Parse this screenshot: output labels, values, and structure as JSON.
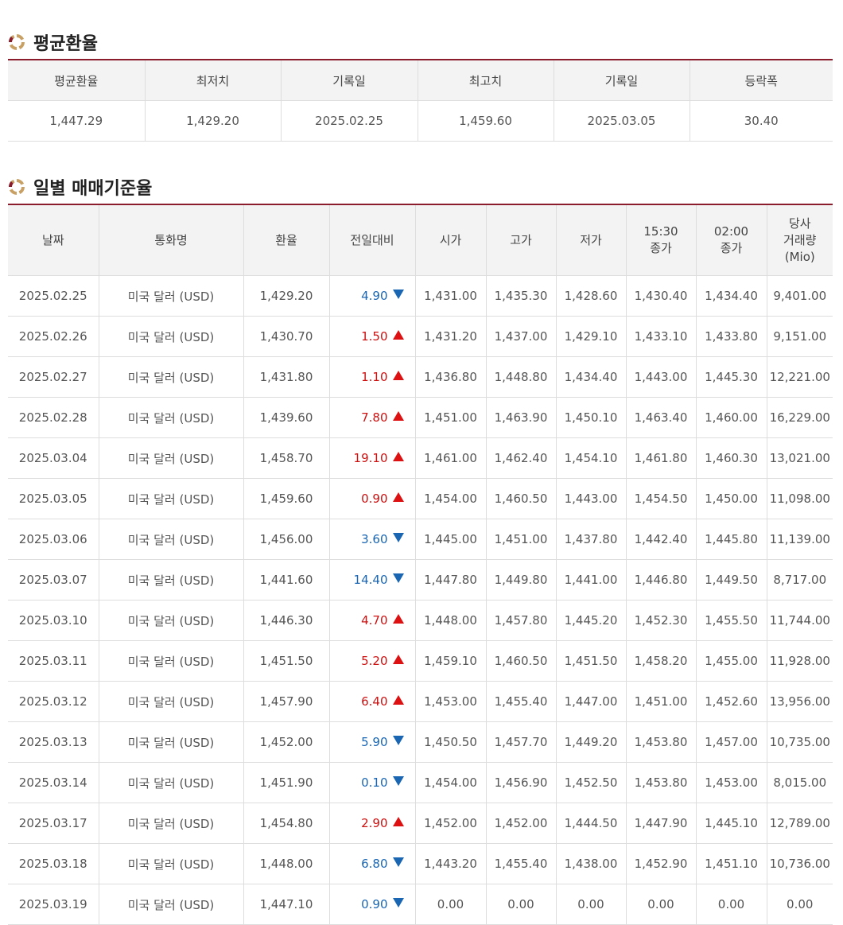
{
  "colors": {
    "accent": "#8a1c2b",
    "up": "#cc1111",
    "down": "#1a66b3"
  },
  "average_section": {
    "title": "평균환율",
    "headers": [
      "평균환율",
      "최저치",
      "기록일",
      "최고치",
      "기록일",
      "등락폭"
    ],
    "values": [
      "1,447.29",
      "1,429.20",
      "2025.02.25",
      "1,459.60",
      "2025.03.05",
      "30.40"
    ]
  },
  "daily_section": {
    "title": "일별 매매기준율",
    "headers": [
      {
        "lines": [
          "날짜"
        ]
      },
      {
        "lines": [
          "통화명"
        ]
      },
      {
        "lines": [
          "환율"
        ]
      },
      {
        "lines": [
          "전일대비"
        ]
      },
      {
        "lines": [
          "시가"
        ]
      },
      {
        "lines": [
          "고가"
        ]
      },
      {
        "lines": [
          "저가"
        ]
      },
      {
        "lines": [
          "15:30",
          "종가"
        ]
      },
      {
        "lines": [
          "02:00",
          "종가"
        ]
      },
      {
        "lines": [
          "당사",
          "거래량",
          "(Mio)"
        ]
      }
    ],
    "rows": [
      {
        "date": "2025.02.25",
        "currency": "미국 달러 (USD)",
        "rate": "1,429.20",
        "change": "4.90",
        "direction": "down",
        "open": "1,431.00",
        "high": "1,435.30",
        "low": "1,428.60",
        "close1530": "1,430.40",
        "close0200": "1,434.40",
        "volume": "9,401.00"
      },
      {
        "date": "2025.02.26",
        "currency": "미국 달러 (USD)",
        "rate": "1,430.70",
        "change": "1.50",
        "direction": "up",
        "open": "1,431.20",
        "high": "1,437.00",
        "low": "1,429.10",
        "close1530": "1,433.10",
        "close0200": "1,433.80",
        "volume": "9,151.00"
      },
      {
        "date": "2025.02.27",
        "currency": "미국 달러 (USD)",
        "rate": "1,431.80",
        "change": "1.10",
        "direction": "up",
        "open": "1,436.80",
        "high": "1,448.80",
        "low": "1,434.40",
        "close1530": "1,443.00",
        "close0200": "1,445.30",
        "volume": "12,221.00"
      },
      {
        "date": "2025.02.28",
        "currency": "미국 달러 (USD)",
        "rate": "1,439.60",
        "change": "7.80",
        "direction": "up",
        "open": "1,451.00",
        "high": "1,463.90",
        "low": "1,450.10",
        "close1530": "1,463.40",
        "close0200": "1,460.00",
        "volume": "16,229.00"
      },
      {
        "date": "2025.03.04",
        "currency": "미국 달러 (USD)",
        "rate": "1,458.70",
        "change": "19.10",
        "direction": "up",
        "open": "1,461.00",
        "high": "1,462.40",
        "low": "1,454.10",
        "close1530": "1,461.80",
        "close0200": "1,460.30",
        "volume": "13,021.00"
      },
      {
        "date": "2025.03.05",
        "currency": "미국 달러 (USD)",
        "rate": "1,459.60",
        "change": "0.90",
        "direction": "up",
        "open": "1,454.00",
        "high": "1,460.50",
        "low": "1,443.00",
        "close1530": "1,454.50",
        "close0200": "1,450.00",
        "volume": "11,098.00"
      },
      {
        "date": "2025.03.06",
        "currency": "미국 달러 (USD)",
        "rate": "1,456.00",
        "change": "3.60",
        "direction": "down",
        "open": "1,445.00",
        "high": "1,451.00",
        "low": "1,437.80",
        "close1530": "1,442.40",
        "close0200": "1,445.80",
        "volume": "11,139.00"
      },
      {
        "date": "2025.03.07",
        "currency": "미국 달러 (USD)",
        "rate": "1,441.60",
        "change": "14.40",
        "direction": "down",
        "open": "1,447.80",
        "high": "1,449.80",
        "low": "1,441.00",
        "close1530": "1,446.80",
        "close0200": "1,449.50",
        "volume": "8,717.00"
      },
      {
        "date": "2025.03.10",
        "currency": "미국 달러 (USD)",
        "rate": "1,446.30",
        "change": "4.70",
        "direction": "up",
        "open": "1,448.00",
        "high": "1,457.80",
        "low": "1,445.20",
        "close1530": "1,452.30",
        "close0200": "1,455.50",
        "volume": "11,744.00"
      },
      {
        "date": "2025.03.11",
        "currency": "미국 달러 (USD)",
        "rate": "1,451.50",
        "change": "5.20",
        "direction": "up",
        "open": "1,459.10",
        "high": "1,460.50",
        "low": "1,451.50",
        "close1530": "1,458.20",
        "close0200": "1,455.00",
        "volume": "11,928.00"
      },
      {
        "date": "2025.03.12",
        "currency": "미국 달러 (USD)",
        "rate": "1,457.90",
        "change": "6.40",
        "direction": "up",
        "open": "1,453.00",
        "high": "1,455.40",
        "low": "1,447.00",
        "close1530": "1,451.00",
        "close0200": "1,452.60",
        "volume": "13,956.00"
      },
      {
        "date": "2025.03.13",
        "currency": "미국 달러 (USD)",
        "rate": "1,452.00",
        "change": "5.90",
        "direction": "down",
        "open": "1,450.50",
        "high": "1,457.70",
        "low": "1,449.20",
        "close1530": "1,453.80",
        "close0200": "1,457.00",
        "volume": "10,735.00"
      },
      {
        "date": "2025.03.14",
        "currency": "미국 달러 (USD)",
        "rate": "1,451.90",
        "change": "0.10",
        "direction": "down",
        "open": "1,454.00",
        "high": "1,456.90",
        "low": "1,452.50",
        "close1530": "1,453.80",
        "close0200": "1,453.00",
        "volume": "8,015.00"
      },
      {
        "date": "2025.03.17",
        "currency": "미국 달러 (USD)",
        "rate": "1,454.80",
        "change": "2.90",
        "direction": "up",
        "open": "1,452.00",
        "high": "1,452.00",
        "low": "1,444.50",
        "close1530": "1,447.90",
        "close0200": "1,445.10",
        "volume": "12,789.00"
      },
      {
        "date": "2025.03.18",
        "currency": "미국 달러 (USD)",
        "rate": "1,448.00",
        "change": "6.80",
        "direction": "down",
        "open": "1,443.20",
        "high": "1,455.40",
        "low": "1,438.00",
        "close1530": "1,452.90",
        "close0200": "1,451.10",
        "volume": "10,736.00"
      },
      {
        "date": "2025.03.19",
        "currency": "미국 달러 (USD)",
        "rate": "1,447.10",
        "change": "0.90",
        "direction": "down",
        "open": "0.00",
        "high": "0.00",
        "low": "0.00",
        "close1530": "0.00",
        "close0200": "0.00",
        "volume": "0.00"
      }
    ]
  }
}
